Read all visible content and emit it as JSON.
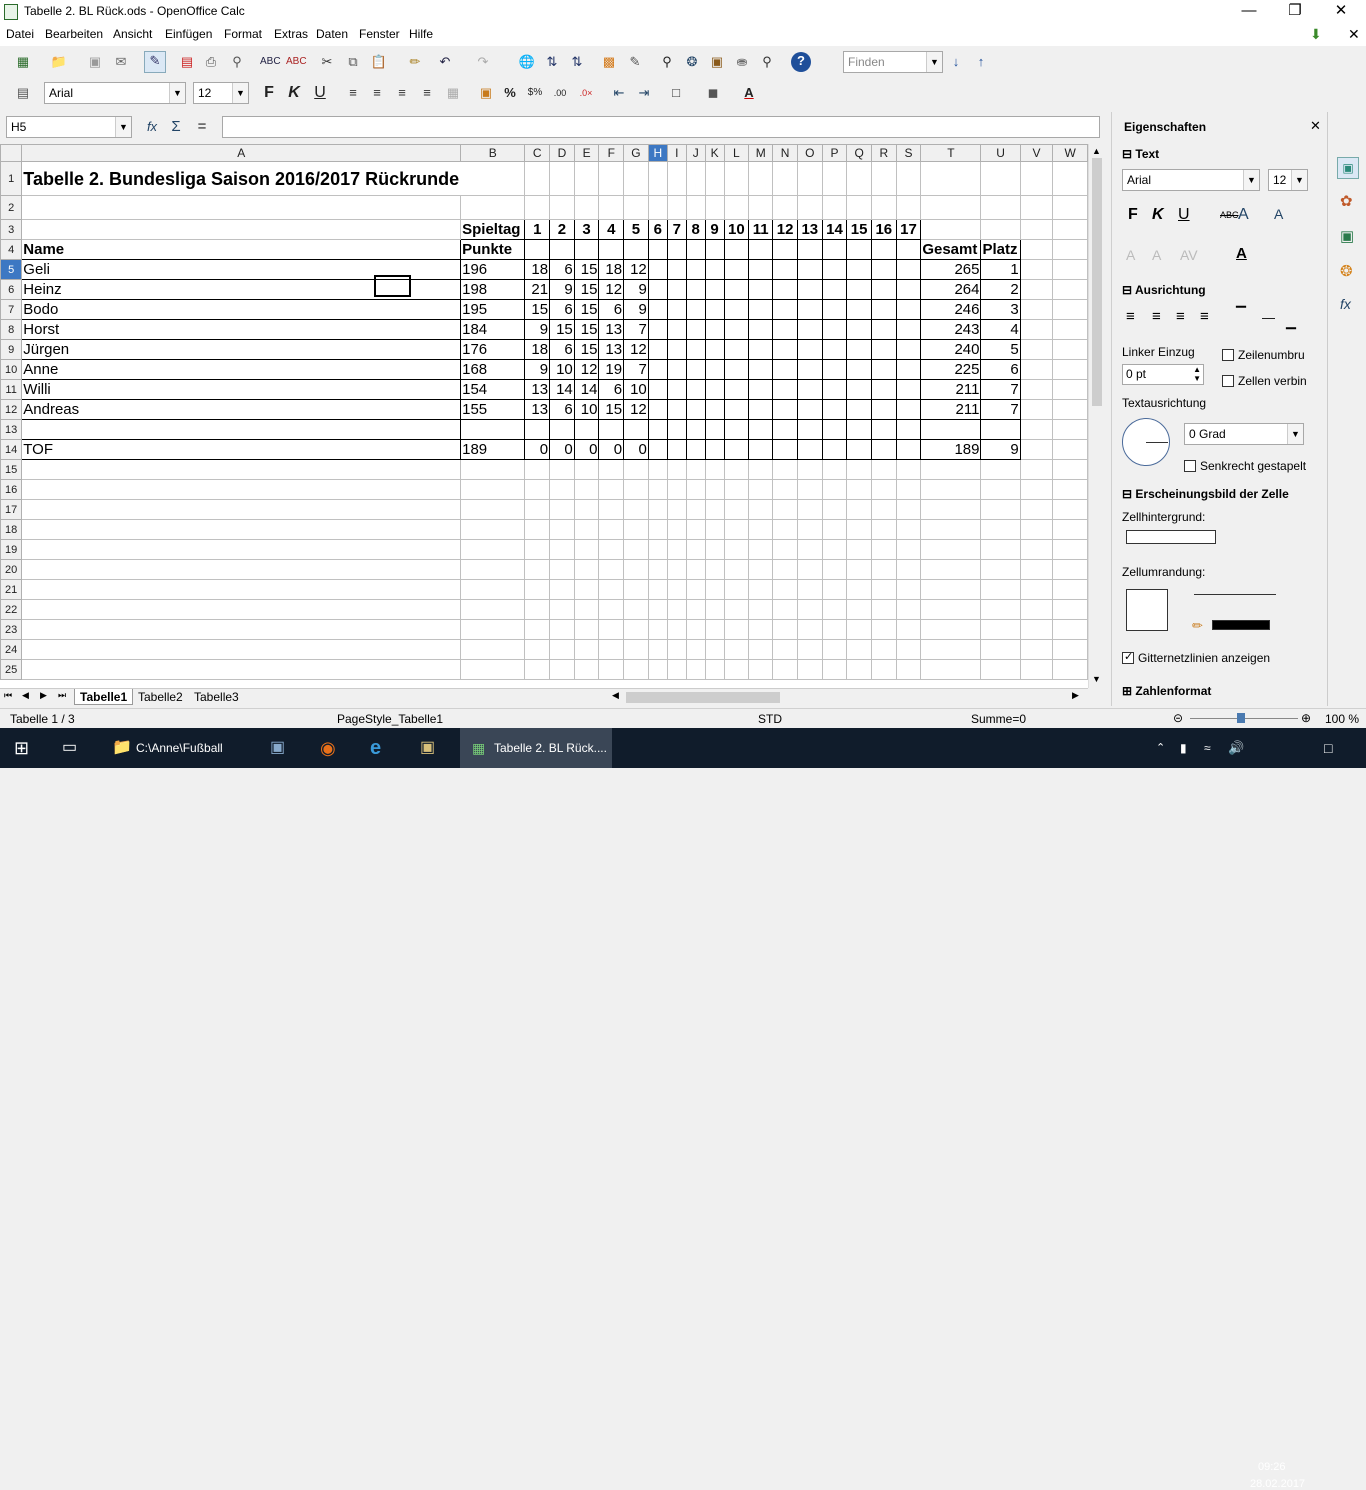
{
  "window": {
    "title": "Tabelle 2. BL Rück.ods - OpenOffice Calc"
  },
  "menu": [
    "Datei",
    "Bearbeiten",
    "Ansicht",
    "Einfügen",
    "Format",
    "Extras",
    "Daten",
    "Fenster",
    "Hilfe"
  ],
  "toolbar": {
    "find_placeholder": "Finden",
    "font_name": "Arial",
    "font_size": "12"
  },
  "formula": {
    "name_box": "H5",
    "equals": "="
  },
  "columns": [
    "A",
    "B",
    "C",
    "D",
    "E",
    "F",
    "G",
    "H",
    "I",
    "J",
    "K",
    "L",
    "M",
    "N",
    "O",
    "P",
    "Q",
    "R",
    "S",
    "T",
    "U",
    "V",
    "W"
  ],
  "selected_column": "H",
  "selected_row": "5",
  "sheet": {
    "title": "Tabelle 2. Bundesliga Saison 2016/2017 Rückrunde",
    "spieltag_label": "Spieltag",
    "spieltage": [
      "1",
      "2",
      "3",
      "4",
      "5",
      "6",
      "7",
      "8",
      "9",
      "10",
      "11",
      "12",
      "13",
      "14",
      "15",
      "16",
      "17"
    ],
    "name_header": "Name",
    "punkte_header": "Punkte",
    "gesamt_header": "Gesamt",
    "platz_header": "Platz",
    "players": [
      {
        "name": "Geli",
        "punkte": "196",
        "c": "18",
        "d": "6",
        "e": "15",
        "f": "18",
        "g": "12",
        "gesamt": "265",
        "platz": "1"
      },
      {
        "name": "Heinz",
        "punkte": "198",
        "c": "21",
        "d": "9",
        "e": "15",
        "f": "12",
        "g": "9",
        "gesamt": "264",
        "platz": "2"
      },
      {
        "name": "Bodo",
        "punkte": "195",
        "c": "15",
        "d": "6",
        "e": "15",
        "f": "6",
        "g": "9",
        "gesamt": "246",
        "platz": "3"
      },
      {
        "name": "Horst",
        "punkte": "184",
        "c": "9",
        "d": "15",
        "e": "15",
        "f": "13",
        "g": "7",
        "gesamt": "243",
        "platz": "4"
      },
      {
        "name": "Jürgen",
        "punkte": "176",
        "c": "18",
        "d": "6",
        "e": "15",
        "f": "13",
        "g": "12",
        "gesamt": "240",
        "platz": "5"
      },
      {
        "name": "Anne",
        "punkte": "168",
        "c": "9",
        "d": "10",
        "e": "12",
        "f": "19",
        "g": "7",
        "gesamt": "225",
        "platz": "6"
      },
      {
        "name": "Willi",
        "punkte": "154",
        "c": "13",
        "d": "14",
        "e": "14",
        "f": "6",
        "g": "10",
        "gesamt": "211",
        "platz": "7"
      },
      {
        "name": "Andreas",
        "punkte": "155",
        "c": "13",
        "d": "6",
        "e": "10",
        "f": "15",
        "g": "12",
        "gesamt": "211",
        "platz": "7"
      }
    ],
    "tof": {
      "name": "TOF",
      "punkte": "189",
      "c": "0",
      "d": "0",
      "e": "0",
      "f": "0",
      "g": "0",
      "gesamt": "189",
      "platz": "9"
    }
  },
  "sheet_tabs": [
    "Tabelle1",
    "Tabelle2",
    "Tabelle3"
  ],
  "active_tab": "Tabelle1",
  "status": {
    "page": "Tabelle 1 / 3",
    "style": "PageStyle_Tabelle1",
    "mode": "STD",
    "sum": "Summe=0",
    "zoom": "100 %"
  },
  "sidebar": {
    "title": "Eigenschaften",
    "text_section": "Text",
    "font": "Arial",
    "size": "12",
    "bold": "F",
    "italic": "K",
    "underline": "U",
    "strike": "ABC",
    "ausrichtung": "Ausrichtung",
    "linker_einzug": "Linker Einzug",
    "einzug_value": "0 pt",
    "zeilenumbruch": "Zeilenumbru",
    "zellen_verbinden": "Zellen verbin",
    "textausrichtung": "Textausrichtung",
    "grad": "0 Grad",
    "senkrecht": "Senkrecht gestapelt",
    "erscheinungsbild": "Erscheinungsbild der Zelle",
    "zellhintergrund": "Zellhintergrund:",
    "zellumrandung": "Zellumrandung:",
    "gitternetz": "Gitternetzlinien anzeigen",
    "zahlenformat": "Zahlenformat"
  },
  "taskbar": {
    "explorer": "C:\\Anne\\Fußball",
    "calc": "Tabelle 2. BL Rück....",
    "time": "09:26",
    "date": "28.02.2017"
  }
}
